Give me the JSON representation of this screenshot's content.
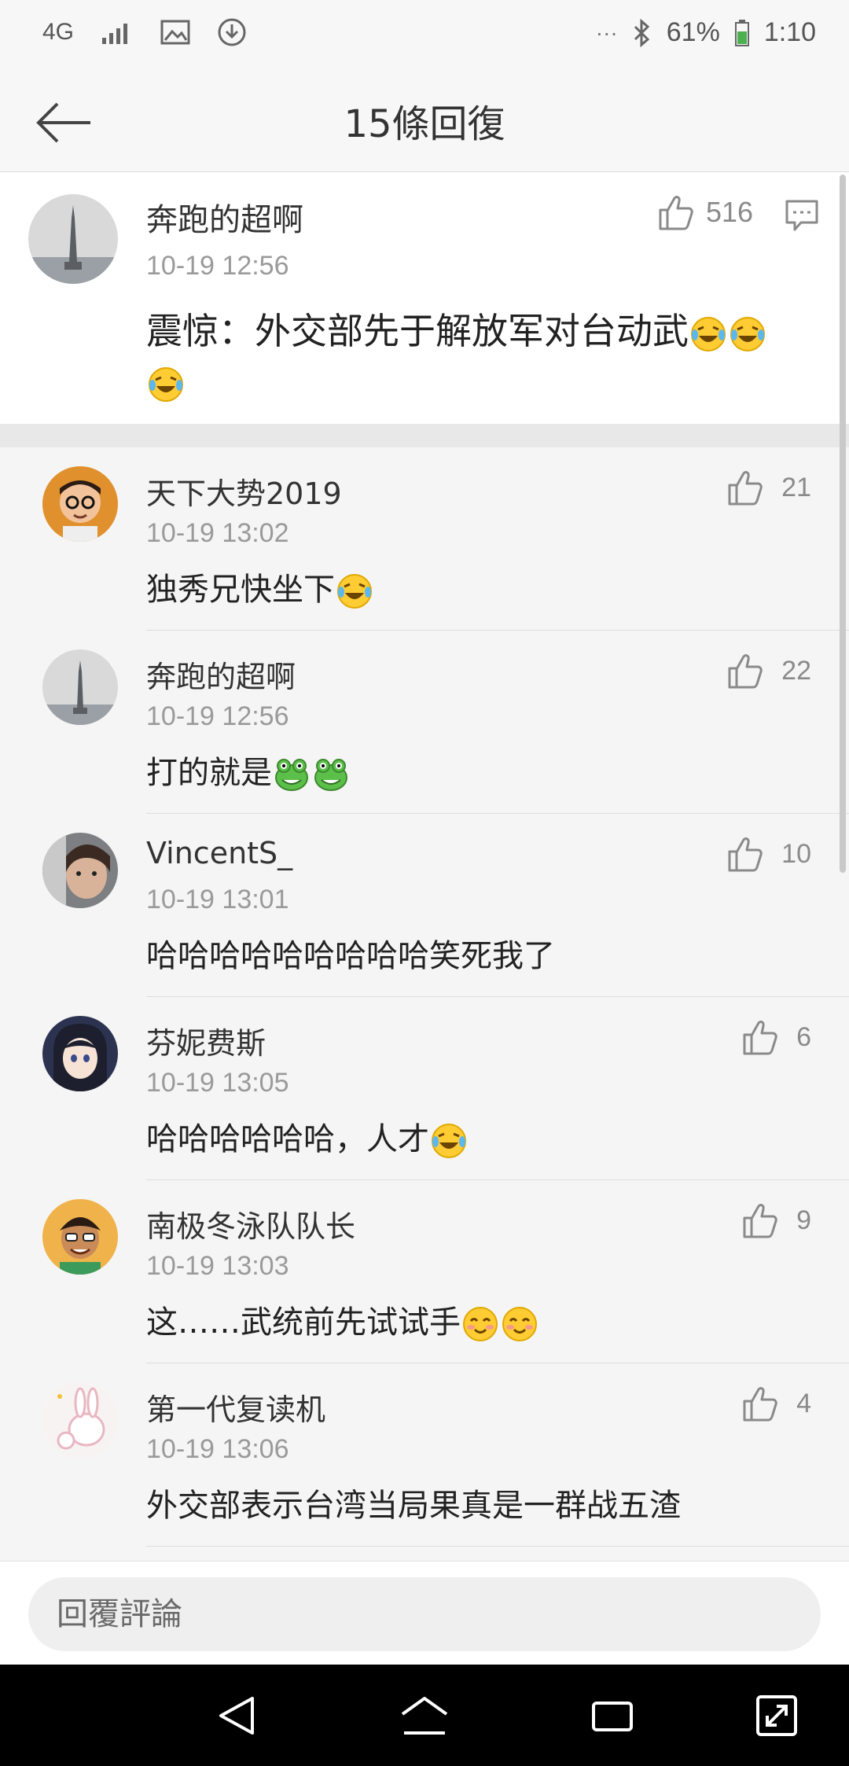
{
  "status_bar": {
    "network": "4G",
    "battery": "61%",
    "time": "1:10",
    "more": "···"
  },
  "header": {
    "title": "15條回復"
  },
  "original_post": {
    "author": "奔跑的超啊",
    "time": "10-19 12:56",
    "text": "震惊：外交部先于解放军对台动武",
    "emojis": [
      "laugh-cry",
      "laugh-cry",
      "laugh-cry"
    ],
    "likes": "516"
  },
  "replies": [
    {
      "author": "天下大势2019",
      "time": "10-19 13:02",
      "text": "独秀兄快坐下",
      "emojis": [
        "laugh-cry"
      ],
      "likes": "21"
    },
    {
      "author": "奔跑的超啊",
      "time": "10-19 12:56",
      "text": "打的就是",
      "emojis": [
        "frog",
        "frog"
      ],
      "likes": "22"
    },
    {
      "author": "VincentS_",
      "time": "10-19 13:01",
      "text": "哈哈哈哈哈哈哈哈哈笑死我了",
      "emojis": [],
      "likes": "10"
    },
    {
      "author": "芬妮费斯",
      "time": "10-19 13:05",
      "text": "哈哈哈哈哈哈，人才",
      "emojis": [
        "laugh-cry"
      ],
      "likes": "6"
    },
    {
      "author": "南极冬泳队队长",
      "time": "10-19 13:03",
      "text": "这……武统前先试试手",
      "emojis": [
        "blush",
        "blush"
      ],
      "likes": "9"
    },
    {
      "author": "第一代复读机",
      "time": "10-19 13:06",
      "text": "外交部表示台湾当局果真是一群战五渣",
      "emojis": [],
      "likes": "4"
    }
  ],
  "reply_box": {
    "placeholder": "回覆評論"
  },
  "colors": {
    "background": "#f5f5f5",
    "post_background": "#ffffff",
    "muted_text": "#9a9a9a",
    "nav_bar": "#000000"
  }
}
